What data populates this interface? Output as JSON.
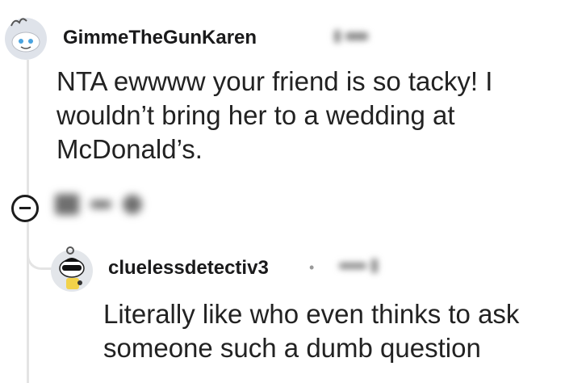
{
  "comments": [
    {
      "username": "GimmeTheGunKaren",
      "body": "NTA ewwww your friend is so tacky! I wouldn’t bring her to a wedding at McDonald’s.",
      "avatar_icon": "snoo-avatar-icon"
    },
    {
      "username": "cluelessdetectiv3",
      "separator": "•",
      "body": "Literally like who even thinks to ask someone such a dumb question",
      "avatar_icon": "snoo-detective-avatar-icon"
    }
  ],
  "icons": {
    "collapse": "collapse-minus-icon"
  },
  "colors": {
    "thread_line": "#e4e4e4",
    "text": "#1c1c1c"
  }
}
